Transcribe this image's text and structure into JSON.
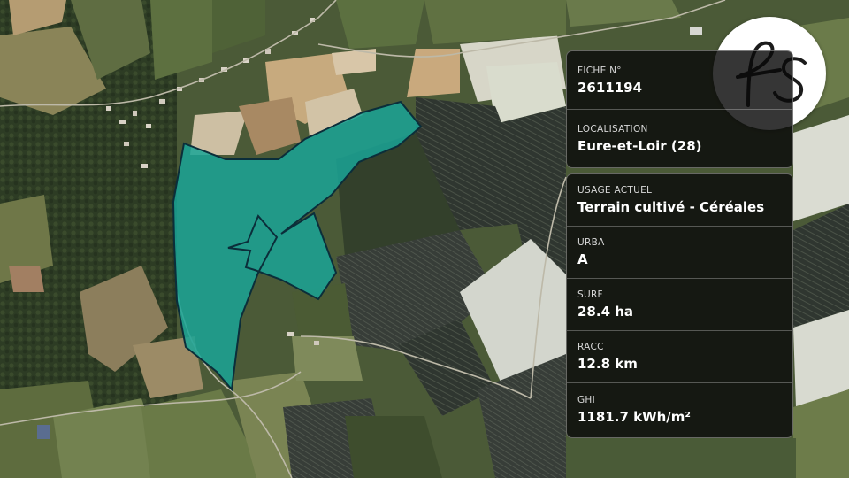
{
  "map": {
    "parcel_color": "#1aa596",
    "parcel_border": "#0b2e3a"
  },
  "logo": {
    "icon": "fs-monogram-logo-icon",
    "letters": "fs"
  },
  "info_top": [
    {
      "label": "FICHE N°",
      "value": "2611194"
    },
    {
      "label": "LOCALISATION",
      "value": "Eure-et-Loir (28)"
    }
  ],
  "info_bottom": [
    {
      "label": "USAGE ACTUEL",
      "value": "Terrain cultivé - Céréales"
    },
    {
      "label": "URBA",
      "value": "A"
    },
    {
      "label": "SURF",
      "value": "28.4 ha"
    },
    {
      "label": "RACC",
      "value": "12.8 km"
    },
    {
      "label": "GHI",
      "value": "1181.7 kWh/m²"
    }
  ]
}
